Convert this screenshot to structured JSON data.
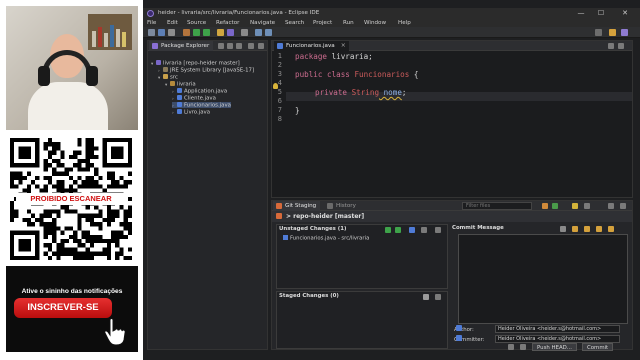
{
  "overlay": {
    "qr_warning": "PROIBIDO ESCANEAR",
    "bell_text": "Ative o sininho das notificações",
    "subscribe_label": "INSCREVER-SE"
  },
  "window": {
    "title": "heider - livraria/src/livraria/Funcionarios.java - Eclipse IDE",
    "controls": [
      "—",
      "☐",
      "✕"
    ]
  },
  "menu": [
    "File",
    "Edit",
    "Source",
    "Refactor",
    "Navigate",
    "Search",
    "Project",
    "Run",
    "Window",
    "Help"
  ],
  "package_explorer": {
    "tab_label": "Package Explorer",
    "tree": [
      {
        "label": "livraria [repo-heider master]",
        "level": 0,
        "kind": "project"
      },
      {
        "label": "JRE System Library [JavaSE-17]",
        "level": 1,
        "kind": "library"
      },
      {
        "label": "src",
        "level": 1,
        "kind": "folder"
      },
      {
        "label": "livraria",
        "level": 2,
        "kind": "package"
      },
      {
        "label": "Application.java",
        "level": 3,
        "kind": "java"
      },
      {
        "label": "Cliente.java",
        "level": 3,
        "kind": "java"
      },
      {
        "label": "Funcionarios.java",
        "level": 3,
        "kind": "java",
        "selected": true
      },
      {
        "label": "Livro.java",
        "level": 3,
        "kind": "java"
      }
    ]
  },
  "editor": {
    "tab_label": "Funcionarios.java",
    "line_numbers": [
      "1",
      "2",
      "3",
      "4",
      "5",
      "6",
      "7",
      "8"
    ],
    "lines": [
      {
        "kw": "package",
        "rest": " livraria;"
      },
      {
        "kw": "",
        "rest": ""
      },
      {
        "kw": "public class",
        "ty": " Funcionarios",
        "rest": " {"
      },
      {
        "kw": "",
        "rest": ""
      },
      {
        "kw": "private",
        "ty": " String",
        "fld": " nome",
        "rest": ";"
      },
      {
        "kw": "",
        "rest": ""
      },
      {
        "kw": "",
        "rest": "}"
      },
      {
        "kw": "",
        "rest": ""
      }
    ]
  },
  "git_staging": {
    "tab_label": "Git Staging",
    "history_tab": "History",
    "filter_placeholder": "Filter files",
    "repo_label": "> repo-heider [master]",
    "unstaged_header": "Unstaged Changes (1)",
    "unstaged_item": "Funcionarios.java - src/livraria",
    "staged_header": "Staged Changes (0)",
    "commit_header": "Commit Message",
    "author_label": "Author:",
    "author_value": "Heider Oliveira <heider.s@hotmail.com>",
    "committer_label": "Committer:",
    "committer_value": "Heider Oliveira <heider.s@hotmail.com>",
    "push_label": "Push HEAD...",
    "commit_label": "Commit"
  },
  "colors": {
    "accent_red": "#d01212",
    "keyword": "#cc6c8f",
    "type": "#cd5c5c"
  }
}
